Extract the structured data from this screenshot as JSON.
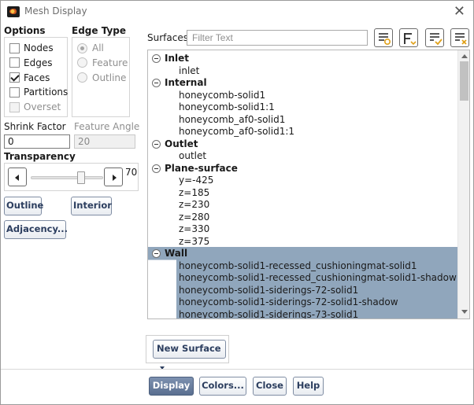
{
  "window": {
    "title": "Mesh Display",
    "close_icon": "close-icon"
  },
  "options": {
    "label": "Options",
    "items": [
      {
        "label": "Nodes",
        "checked": false,
        "disabled": false
      },
      {
        "label": "Edges",
        "checked": false,
        "disabled": false
      },
      {
        "label": "Faces",
        "checked": true,
        "disabled": false
      },
      {
        "label": "Partitions",
        "checked": false,
        "disabled": false
      },
      {
        "label": "Overset",
        "checked": false,
        "disabled": true
      }
    ]
  },
  "edge_type": {
    "label": "Edge Type",
    "items": [
      {
        "label": "All",
        "selected": true
      },
      {
        "label": "Feature",
        "selected": false
      },
      {
        "label": "Outline",
        "selected": false
      }
    ]
  },
  "shrink_factor": {
    "label": "Shrink Factor",
    "value": "0"
  },
  "feature_angle": {
    "label": "Feature Angle",
    "value": "20"
  },
  "transparency": {
    "label": "Transparency",
    "value": "70",
    "level": 0.7
  },
  "buttons": {
    "outline": "Outline",
    "interior": "Interior",
    "adjacency": "Adjacency...",
    "new_surface": "New Surface",
    "display": "Display",
    "colors": "Colors...",
    "close": "Close",
    "help": "Help"
  },
  "surfaces": {
    "label": "Surfaces",
    "filter_placeholder": "Filter Text",
    "toolbar_icons": [
      "select-all-icon",
      "group-icon",
      "check-selected-icon",
      "deselect-icon"
    ],
    "groups": [
      {
        "name": "Inlet",
        "items": [
          "inlet"
        ]
      },
      {
        "name": "Internal",
        "items": [
          "honeycomb-solid1",
          "honeycomb-solid1:1",
          "honeycomb_af0-solid1",
          "honeycomb_af0-solid1:1"
        ]
      },
      {
        "name": "Outlet",
        "items": [
          "outlet"
        ]
      },
      {
        "name": "Plane-surface",
        "items": [
          "y=-425",
          "z=185",
          "z=230",
          "z=280",
          "z=330",
          "z=375"
        ]
      },
      {
        "name": "Wall",
        "selected": true,
        "items": [
          "honeycomb-solid1-recessed_cushioningmat-solid1",
          "honeycomb-solid1-recessed_cushioningmat-solid1-shadow",
          "honeycomb-solid1-siderings-72-solid1",
          "honeycomb-solid1-siderings-72-solid1-shadow",
          "honeycomb-solid1-siderings-73-solid1"
        ]
      }
    ]
  },
  "colors": {
    "selection": "#90a6bc",
    "primary_button": "#5a6f90"
  }
}
